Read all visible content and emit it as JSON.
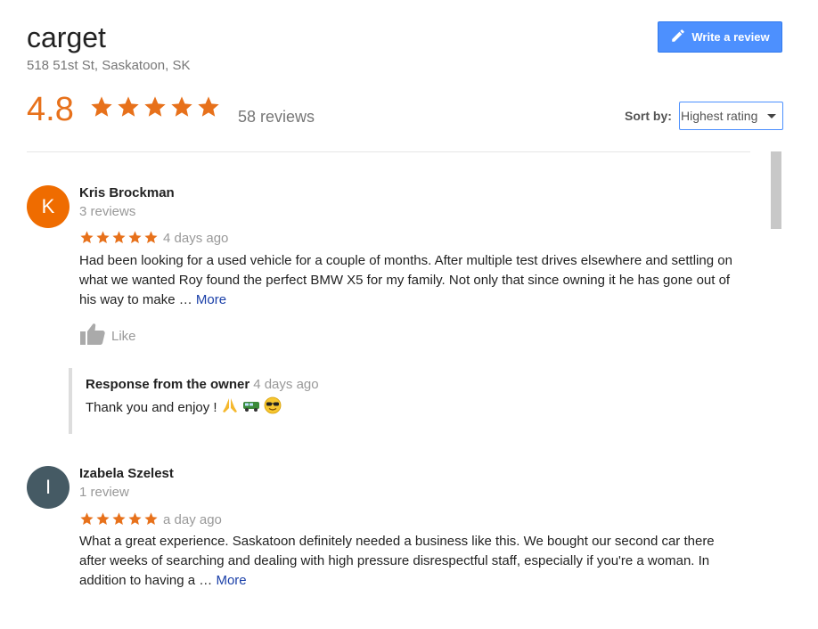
{
  "business": {
    "name": "carget",
    "address": "518 51st St, Saskatoon, SK",
    "rating": "4.8",
    "review_count": "58 reviews",
    "star_color": "#e7711b"
  },
  "header": {
    "write_review_label": "Write a review",
    "sort_label": "Sort by:",
    "sort_value": "Highest rating"
  },
  "reviews": [
    {
      "initial": "K",
      "avatar_color": "#ef6c00",
      "name": "Kris Brockman",
      "count": "3 reviews",
      "stars": 5,
      "time": "4 days ago",
      "text": "Had been looking for a used vehicle for a couple of months. After multiple test drives elsewhere and settling on what we wanted Roy found the perfect BMW X5 for my family. Not only that since owning it he has gone out of his way to make …",
      "more": "More",
      "like": "Like",
      "owner_response": {
        "title": "Response from the owner",
        "time": "4 days ago",
        "text": "Thank you and enjoy !"
      }
    },
    {
      "initial": "I",
      "avatar_color": "#455a64",
      "name": "Izabela Szelest",
      "count": "1 review",
      "stars": 5,
      "time": "a day ago",
      "text": "What a great experience. Saskatoon definitely needed a business like this. We bought our second car there after weeks of searching and dealing with high pressure disrespectful staff, especially if you're a woman. In addition to having a …",
      "more": "More"
    }
  ]
}
